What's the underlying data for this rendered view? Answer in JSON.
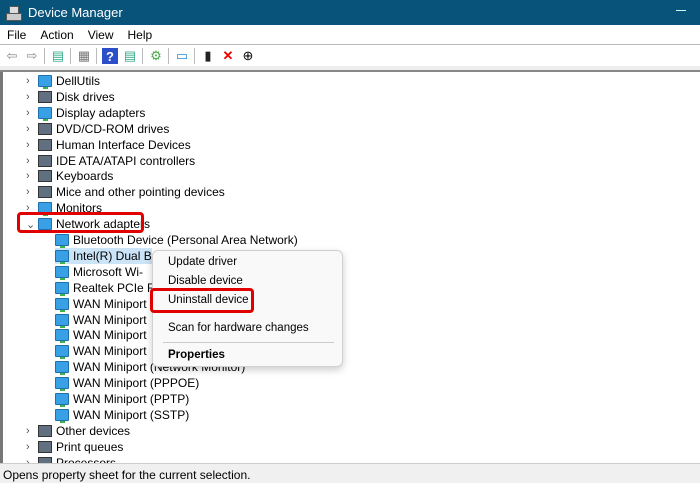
{
  "window": {
    "title": "Device Manager"
  },
  "menu": [
    "File",
    "Action",
    "View",
    "Help"
  ],
  "toolbar": [
    "back-icon",
    "forward-icon",
    "show-hide-tree-icon",
    "properties-sheet-icon",
    "help-icon",
    "action-pane-icon",
    "update-driver-icon",
    "scan-hardware-icon",
    "enable-device-icon",
    "uninstall-icon",
    "disable-device-icon"
  ],
  "tree": {
    "categories_top": [
      "DellUtils",
      "Disk drives",
      "Display adapters",
      "DVD/CD-ROM drives",
      "Human Interface Devices",
      "IDE ATA/ATAPI controllers",
      "Keyboards",
      "Mice and other pointing devices",
      "Monitors"
    ],
    "expanded": "Network adapters",
    "children": [
      "Bluetooth Device (Personal Area Network)",
      "Intel(R) Dual B",
      "Microsoft Wi-",
      "Realtek PCIe F",
      "WAN Miniport",
      "WAN Miniport",
      "WAN Miniport",
      "WAN Miniport",
      "WAN Miniport (Network Monitor)",
      "WAN Miniport (PPPOE)",
      "WAN Miniport (PPTP)",
      "WAN Miniport (SSTP)"
    ],
    "categories_bottom": [
      "Other devices",
      "Print queues",
      "Processors"
    ]
  },
  "context_menu": {
    "update": "Update driver",
    "disable": "Disable device",
    "uninstall": "Uninstall device",
    "scan": "Scan for hardware changes",
    "properties": "Properties"
  },
  "status": "Opens property sheet for the current selection.",
  "colors": {
    "titlebar": "#08537a",
    "highlight": "#e00000",
    "selection": "#cce4f7"
  }
}
